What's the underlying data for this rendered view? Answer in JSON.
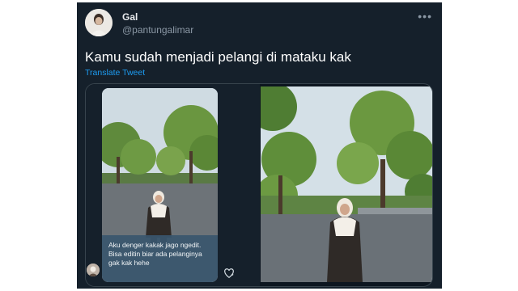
{
  "tweet": {
    "display_name": "Gal",
    "handle": "@pantungalimar",
    "more_label": "•••",
    "text": "Kamu sudah menjadi pelangi di mataku kak",
    "translate_label": "Translate Tweet"
  },
  "media": {
    "story_caption": [
      "Aku denger kakak jago ngedit.",
      "Bisa editin biar ada pelanginya",
      "gak kak hehe"
    ]
  },
  "colors": {
    "background": "#15202b",
    "link": "#1d9bf0",
    "secondary_text": "#8b98a5"
  },
  "icons": {
    "more": "more-dots-icon",
    "like": "heart-icon"
  }
}
